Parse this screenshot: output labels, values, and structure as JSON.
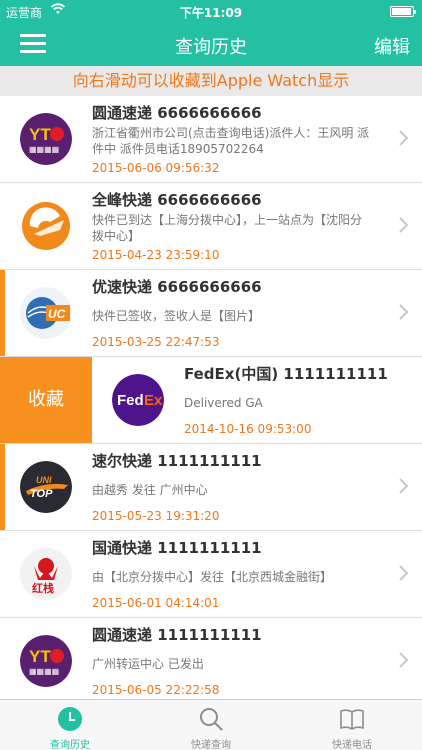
{
  "status_bar": {
    "carrier": "运营商",
    "time": "下午11:09"
  },
  "nav": {
    "title": "查询历史",
    "edit_label": "编辑"
  },
  "banner": {
    "text": "向右滑动可以收藏到Apple Watch显示"
  },
  "colors": {
    "accent": "#23c0a4",
    "orange": "#f0761b",
    "swipe_orange": "#f7901e"
  },
  "swipe_action": {
    "label": "收藏"
  },
  "records": [
    {
      "company": "圆通速递 6666666666",
      "status": "浙江省衢州市公司(点击查询电话)派件人：王风明 派件中 派件员电话18905702264",
      "time": "2015-06-06 09:56:32",
      "logo": "yto-logo",
      "highlighted": false
    },
    {
      "company": "全峰快递 6666666666",
      "status": "快件已到达【上海分拨中心】，上一站点为【沈阳分拨中心】",
      "time": "2015-04-23 23:59:10",
      "logo": "qfkd-logo",
      "highlighted": false
    },
    {
      "company": "优速快递 6666666666",
      "status": "快件已签收，签收人是【图片】",
      "time": "2015-03-25 22:47:53",
      "logo": "uc-logo",
      "highlighted": true
    },
    {
      "company": "FedEx(中国) 1111111111",
      "status": "Delivered GA",
      "time": "2014-10-16 09:53:00",
      "logo": "fedex-logo",
      "highlighted": false
    },
    {
      "company": "速尔快递 1111111111",
      "status": "由越秀 发往 广州中心",
      "time": "2015-05-23 19:31:20",
      "logo": "unitop-logo",
      "highlighted": true
    },
    {
      "company": "国通快递 1111111111",
      "status": "由【北京分拨中心】发往【北京西城金融街】",
      "time": "2015-06-01 04:14:01",
      "logo": "gto-logo",
      "highlighted": false
    },
    {
      "company": "圆通速递 1111111111",
      "status": "广州转运中心 已发出",
      "time": "2015-06-05 22:22:58",
      "logo": "yto-logo",
      "highlighted": false
    }
  ],
  "tabs": [
    {
      "label": "查询历史",
      "icon": "clock-icon",
      "active": true
    },
    {
      "label": "快递查询",
      "icon": "search-icon",
      "active": false
    },
    {
      "label": "快递电话",
      "icon": "book-icon",
      "active": false
    }
  ]
}
